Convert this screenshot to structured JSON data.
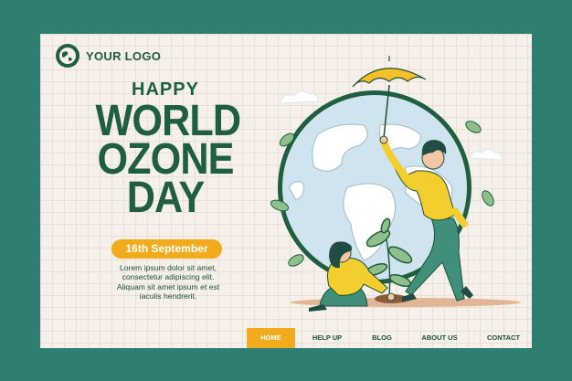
{
  "logo": {
    "text": "YOUR LOGO",
    "icon": "globe-icon"
  },
  "headline": {
    "happy": "HAPPY",
    "line1": "WORLD",
    "line2": "OZONE",
    "line3": "DAY"
  },
  "date": "16th September",
  "description": [
    "Lorem ipsum dolor sit amet,",
    "consectetur adipiscing elit.",
    "Aliquam sit amet ipsum et est",
    "iaculis hendrerit."
  ],
  "nav": {
    "items": [
      {
        "label": "HOME",
        "active": true
      },
      {
        "label": "HELP UP",
        "active": false
      },
      {
        "label": "BLOG",
        "active": false
      },
      {
        "label": "ABOUT US",
        "active": false
      },
      {
        "label": "CONTACT",
        "active": false
      }
    ]
  },
  "colors": {
    "background": "#2e7f72",
    "panel": "#f5f1ea",
    "primary_green": "#1f5e3f",
    "accent_yellow": "#f1ab1c",
    "globe_blue": "#cfe4ee"
  }
}
